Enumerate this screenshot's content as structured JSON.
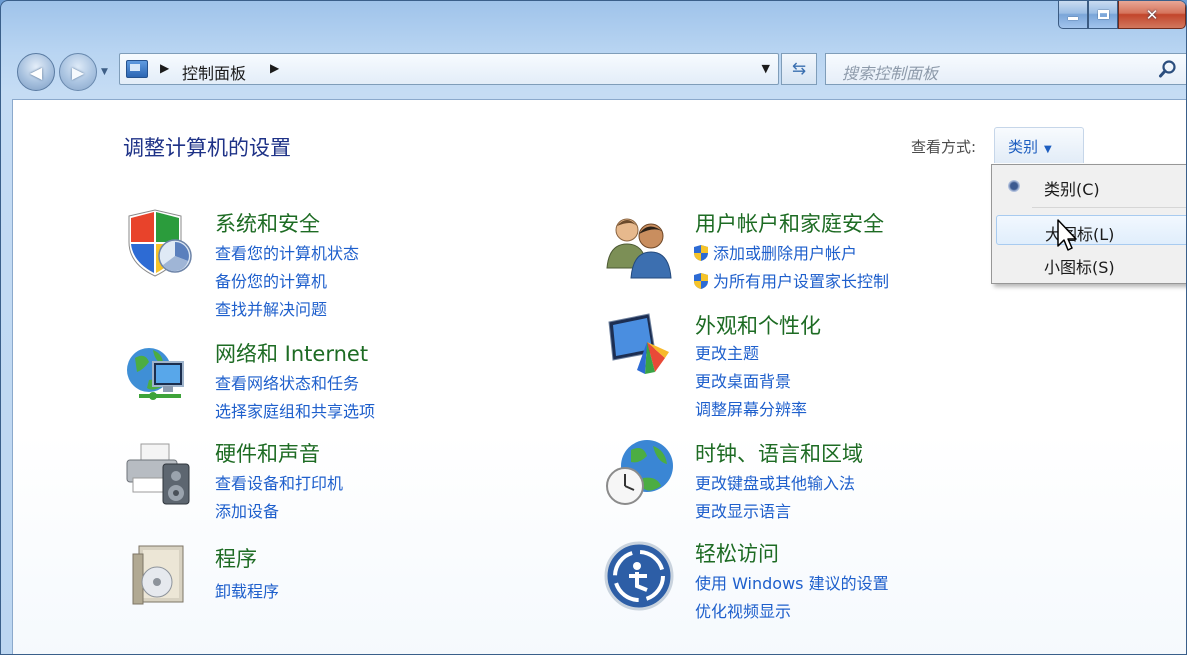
{
  "window": {
    "address": {
      "location": "控制面板"
    },
    "search": {
      "placeholder": "搜索控制面板"
    }
  },
  "page": {
    "title": "调整计算机的设置",
    "view_by_label": "查看方式:",
    "view_by_value": "类别",
    "view_menu": [
      "类别(C)",
      "大图标(L)",
      "小图标(S)"
    ]
  },
  "categories": {
    "system": {
      "title": "系统和安全",
      "links": [
        "查看您的计算机状态",
        "备份您的计算机",
        "查找并解决问题"
      ]
    },
    "network": {
      "title": "网络和 Internet",
      "links": [
        "查看网络状态和任务",
        "选择家庭组和共享选项"
      ]
    },
    "hardware": {
      "title": "硬件和声音",
      "links": [
        "查看设备和打印机",
        "添加设备"
      ]
    },
    "programs": {
      "title": "程序",
      "links": [
        "卸载程序"
      ]
    },
    "accounts": {
      "title": "用户帐户和家庭安全",
      "links": [
        "添加或删除用户帐户",
        "为所有用户设置家长控制"
      ]
    },
    "appearance": {
      "title": "外观和个性化",
      "links": [
        "更改主题",
        "更改桌面背景",
        "调整屏幕分辨率"
      ]
    },
    "clock": {
      "title": "时钟、语言和区域",
      "links": [
        "更改键盘或其他输入法",
        "更改显示语言"
      ]
    },
    "ease": {
      "title": "轻松访问",
      "links": [
        "使用 Windows 建议的设置",
        "优化视频显示"
      ]
    }
  },
  "colors": {
    "category_title": "#1d6b23",
    "link": "#1e5fcc",
    "page_title": "#1e3287"
  }
}
